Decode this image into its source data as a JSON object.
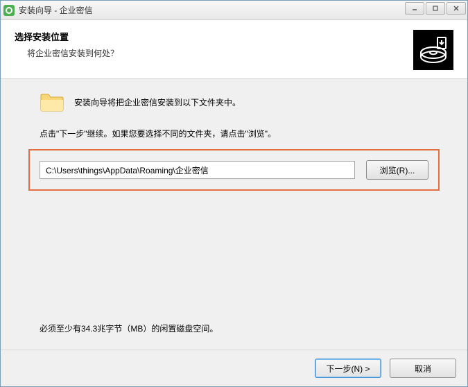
{
  "titlebar": {
    "title": "安装向导 - 企业密信"
  },
  "header": {
    "heading": "选择安装位置",
    "subheading": "将企业密信安装到何处？"
  },
  "content": {
    "install_info": "安装向导将把企业密信安装到以下文件夹中。",
    "instruction": "点击\"下一步\"继续。如果您要选择不同的文件夹，请点击\"浏览\"。",
    "path_value": "C:\\Users\\things\\AppData\\Roaming\\企业密信",
    "browse_label": "浏览(R)...",
    "disk_space": "必须至少有34.3兆字节（MB）的闲置磁盘空间。"
  },
  "footer": {
    "next_label": "下一步(N) >",
    "cancel_label": "取消"
  }
}
